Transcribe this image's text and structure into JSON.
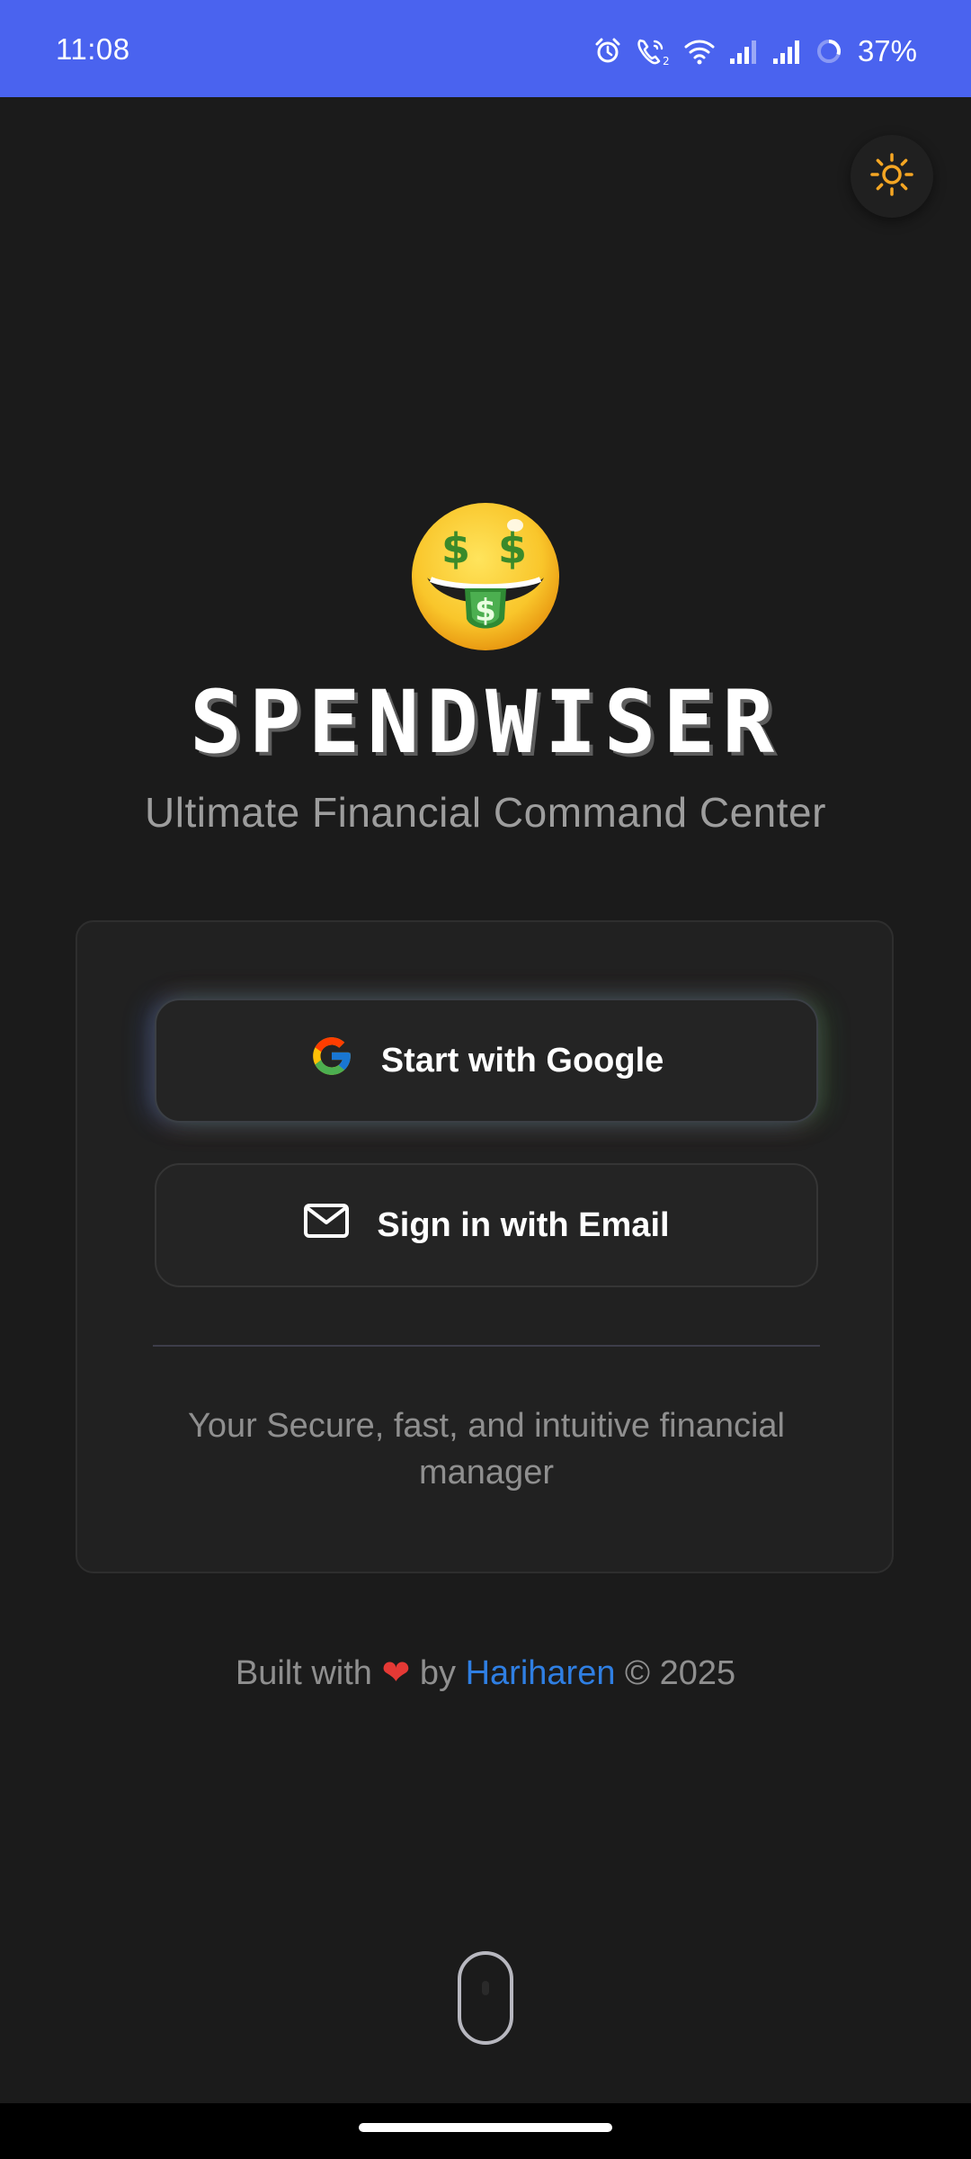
{
  "status_bar": {
    "time": "11:08",
    "battery": "37%",
    "icons": [
      "alarm-icon",
      "wifi-calling-icon",
      "wifi-icon",
      "signal-1-icon",
      "signal-2-icon",
      "battery-ring-icon"
    ],
    "background_color": "#4a63ef"
  },
  "theme_toggle": {
    "icon": "sun-icon",
    "color": "#f5a623"
  },
  "hero": {
    "emoji": "money-mouth-face-icon",
    "title": "SPENDWISER",
    "subtitle": "Ultimate Financial Command Center"
  },
  "auth": {
    "google_label": "Start with Google",
    "email_label": "Sign in with Email",
    "tagline": "Your Secure, fast, and intuitive financial manager"
  },
  "footer": {
    "prefix": "Built with",
    "heart": "❤",
    "by": "by",
    "author": "Hariharen",
    "suffix": "© 2025"
  },
  "colors": {
    "background": "#1b1b1b",
    "card": "#212121",
    "link": "#2f7fe3",
    "heart": "#e53935"
  }
}
